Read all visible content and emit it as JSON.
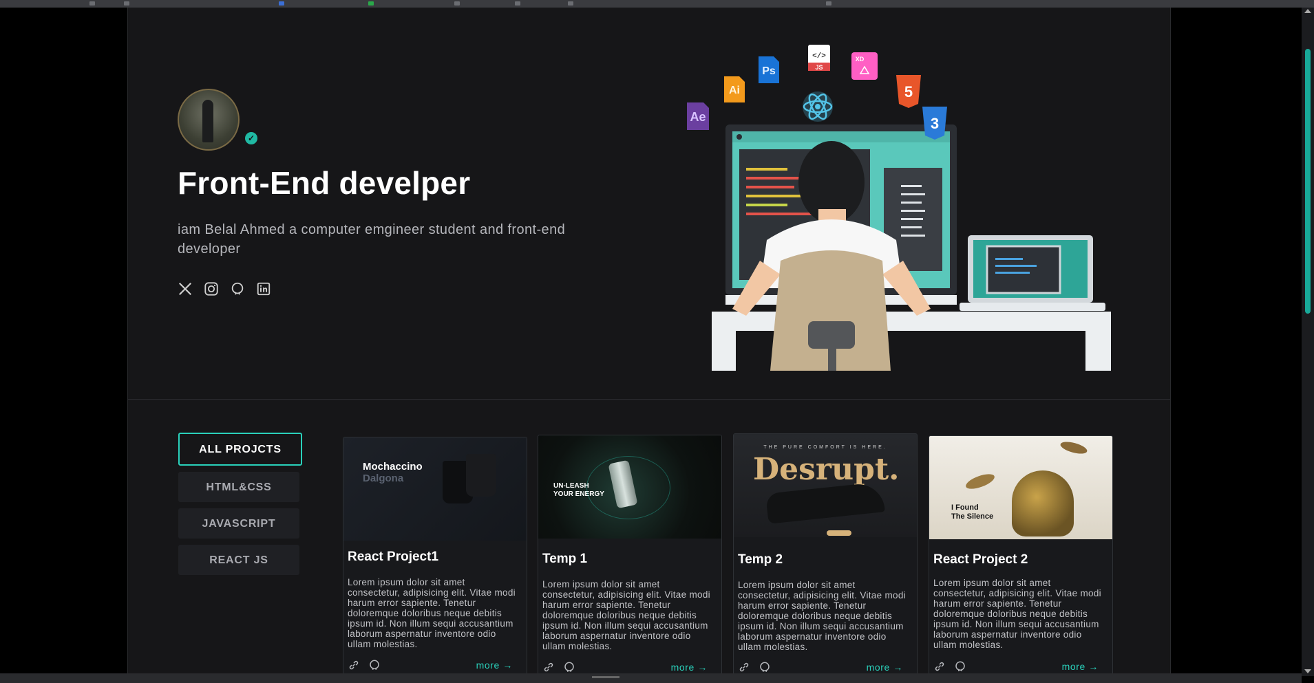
{
  "hero": {
    "title": "Front-End develper",
    "subtitle": "iam Belal Ahmed a computer emgineer student and front-end developer",
    "socials": [
      "x-icon",
      "instagram-icon",
      "github-icon",
      "linkedin-icon"
    ],
    "tech_icons": {
      "ae": "Ae",
      "ai": "Ai",
      "ps": "Ps",
      "js": "JS",
      "xd": "XD",
      "html": "5",
      "css": "3"
    }
  },
  "filters": [
    {
      "label": "ALL PROJCTS",
      "active": true
    },
    {
      "label": "HTML&CSS",
      "active": false
    },
    {
      "label": "JAVASCRIPT",
      "active": false
    },
    {
      "label": "REACT JS",
      "active": false
    }
  ],
  "projects": [
    {
      "title": "React Project1",
      "description": "Lorem ipsum dolor sit amet consectetur, adipisicing elit. Vitae modi harum error sapiente. Tenetur doloremque doloribus neque debitis ipsum id. Non illum sequi accusantium laborum aspernatur inventore odio ullam molestias.",
      "more": "more",
      "thumb_text": [
        "Mochaccino",
        "Dalgona"
      ]
    },
    {
      "title": "Temp 1",
      "description": "Lorem ipsum dolor sit amet consectetur, adipisicing elit. Vitae modi harum error sapiente. Tenetur doloremque doloribus neque debitis ipsum id. Non illum sequi accusantium laborum aspernatur inventore odio ullam molestias.",
      "more": "more",
      "thumb_text": [
        "UN-LEASH",
        "YOUR ENERGY"
      ]
    },
    {
      "title": "Temp 2",
      "description": "Lorem ipsum dolor sit amet consectetur, adipisicing elit. Vitae modi harum error sapiente. Tenetur doloremque doloribus neque debitis ipsum id. Non illum sequi accusantium laborum aspernatur inventore odio ullam molestias.",
      "more": "more",
      "thumb_text": [
        "THE PURE COMFORT IS HERE.",
        "Desrupt."
      ]
    },
    {
      "title": "React Project 2",
      "description": "Lorem ipsum dolor sit amet consectetur, adipisicing elit. Vitae modi harum error sapiente. Tenetur doloremque doloribus neque debitis ipsum id. Non illum sequi accusantium laborum aspernatur inventore odio ullam molestias.",
      "more": "more",
      "thumb_text": [
        "I Found",
        "The Silence"
      ]
    }
  ],
  "colors": {
    "accent": "#2ad1bb",
    "background": "#161618",
    "card": "#18191c"
  }
}
